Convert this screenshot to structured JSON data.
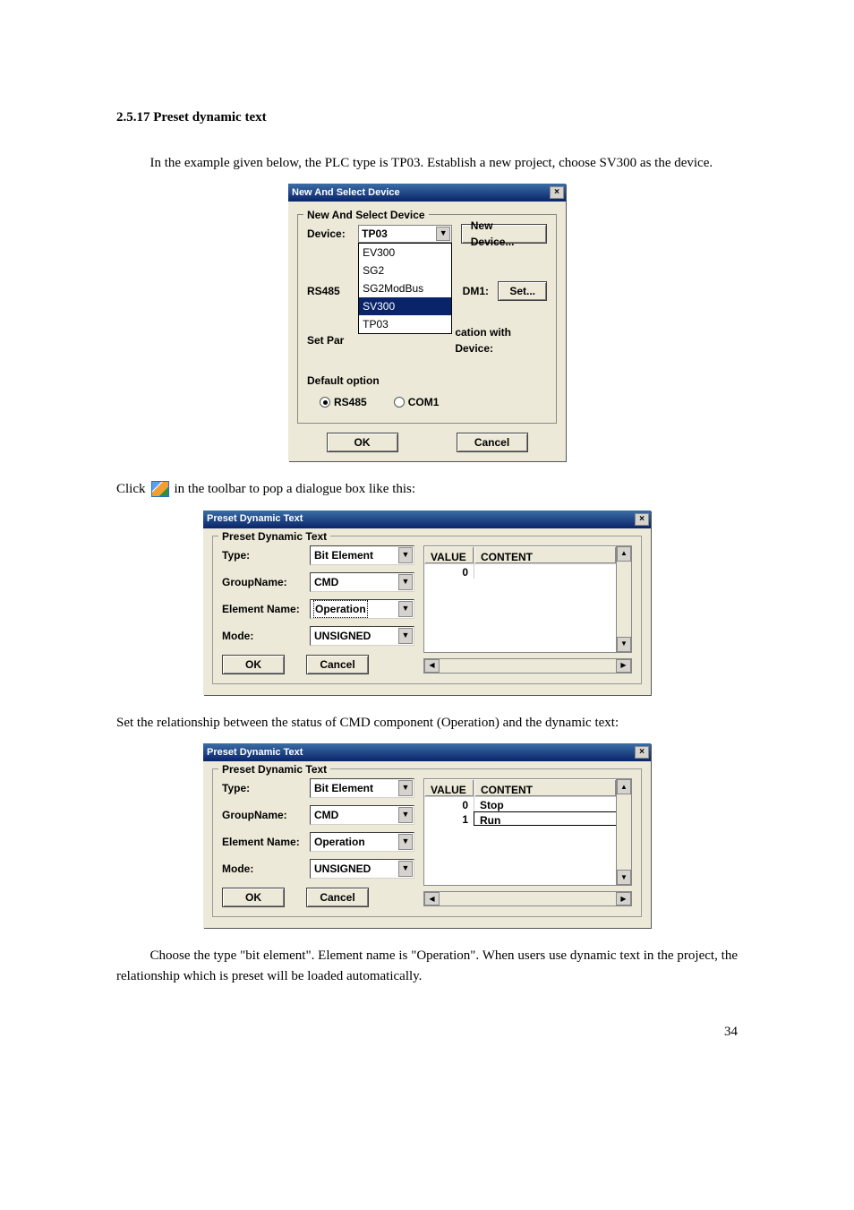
{
  "section": {
    "heading": "2.5.17 Preset dynamic text",
    "para1": "In the example given below, the PLC type is TP03. Establish a new project, choose SV300 as the device.",
    "click_pre": "Click ",
    "click_post": " in the toolbar to pop a dialogue box like this:",
    "para2": "Set the relationship between the status of CMD component (Operation) and the dynamic text:",
    "para3": "Choose the type \"bit element\". Element name is \"Operation\". When users use dynamic text in the project, the relationship which is preset will be loaded automatically.",
    "page": "34"
  },
  "dialog1": {
    "title": "New And Select Device",
    "group": "New And Select Device",
    "device_lbl": "Device:",
    "device_val": "TP03",
    "new_device": "New Device...",
    "setpar_lbl": "Set Par",
    "comm_suffix": "cation with Device:",
    "rs485_lbl": "RS485",
    "com1_rt_lbl": "DM1:",
    "set_btn": "Set...",
    "default_lbl": "Default option",
    "radio_rs485": "RS485",
    "radio_com1": "COM1",
    "ok": "OK",
    "cancel": "Cancel",
    "options": [
      "EV300",
      "SG2",
      "SG2ModBus",
      "SV300",
      "TP03"
    ],
    "selected_option": "SV300"
  },
  "dialog2": {
    "title": "Preset Dynamic Text",
    "group": "Preset Dynamic Text",
    "type_lbl": "Type:",
    "type_val": "Bit Element",
    "group_lbl": "GroupName:",
    "group_val": "CMD",
    "elem_lbl": "Element Name:",
    "elem_val": "Operation",
    "mode_lbl": "Mode:",
    "mode_val": "UNSIGNED",
    "ok": "OK",
    "cancel": "Cancel",
    "th_value": "VALUE",
    "th_content": "CONTENT",
    "rows": [
      {
        "value": "0",
        "content": ""
      }
    ]
  },
  "dialog3": {
    "title": "Preset Dynamic Text",
    "group": "Preset Dynamic Text",
    "type_lbl": "Type:",
    "type_val": "Bit Element",
    "group_lbl": "GroupName:",
    "group_val": "CMD",
    "elem_lbl": "Element Name:",
    "elem_val": "Operation",
    "mode_lbl": "Mode:",
    "mode_val": "UNSIGNED",
    "ok": "OK",
    "cancel": "Cancel",
    "th_value": "VALUE",
    "th_content": "CONTENT",
    "rows": [
      {
        "value": "0",
        "content": "Stop"
      },
      {
        "value": "1",
        "content": "Run"
      }
    ]
  }
}
